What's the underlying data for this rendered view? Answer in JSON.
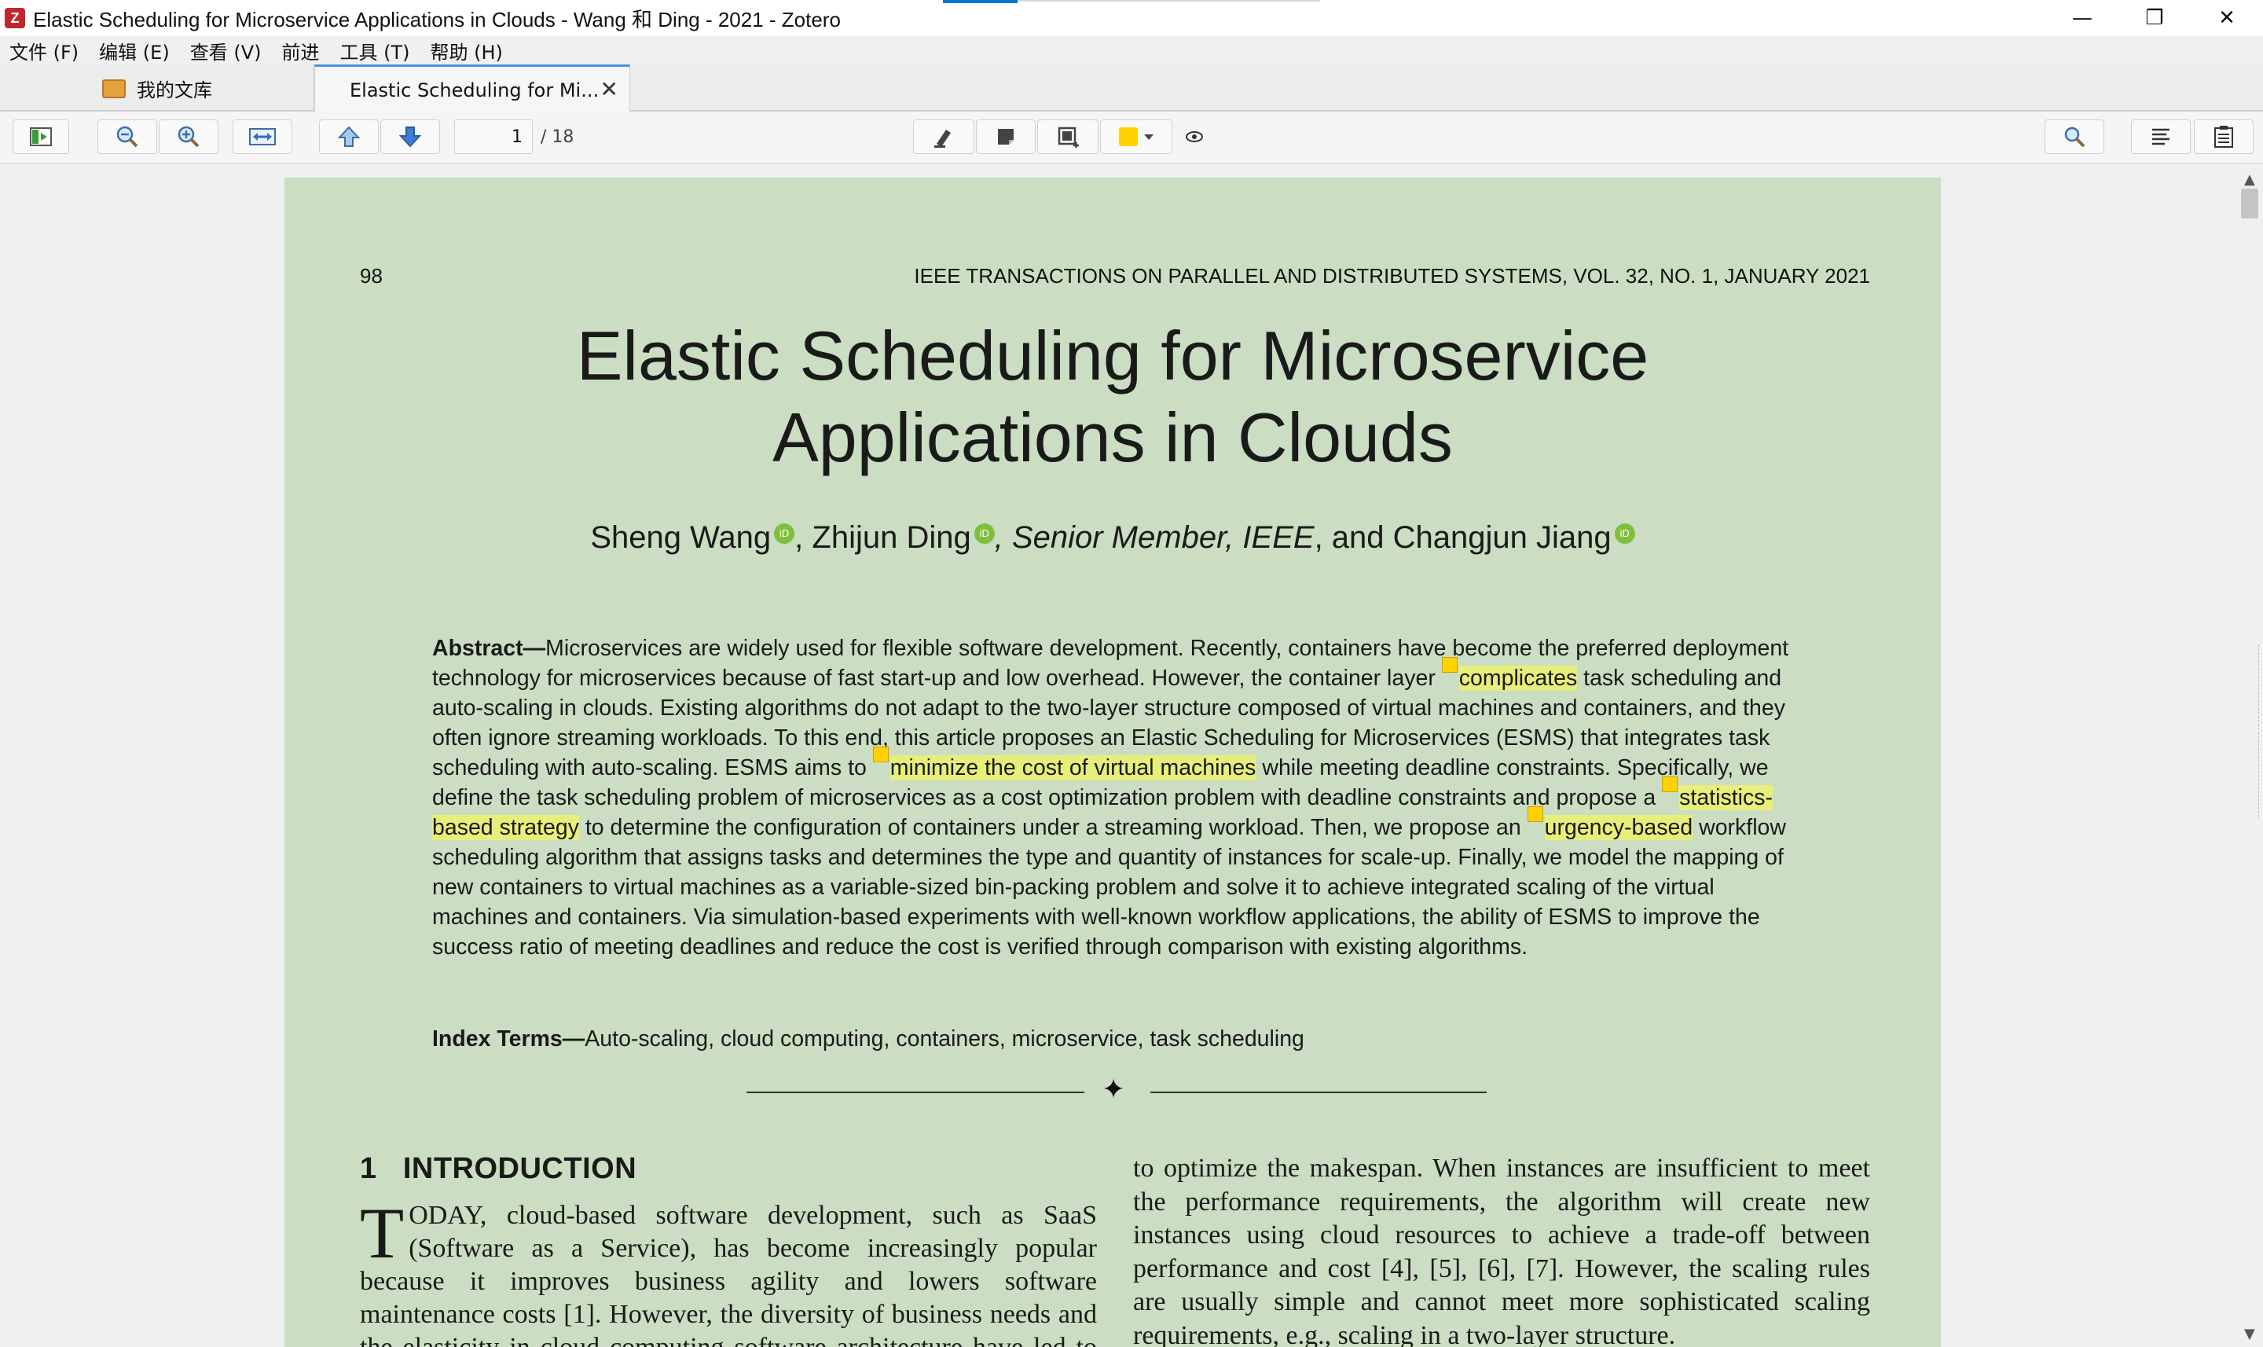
{
  "window": {
    "title": "Elastic Scheduling for Microservice Applications in Clouds - Wang 和 Ding - 2021 - Zotero",
    "minimize": "—",
    "restore": "❐",
    "close": "✕"
  },
  "menu": [
    "文件 (F)",
    "编辑 (E)",
    "查看 (V)",
    "前进",
    "工具 (T)",
    "帮助 (H)"
  ],
  "tabs": {
    "library": "我的文库",
    "reader": "Elastic Scheduling for Mi...",
    "close": "✕"
  },
  "toolbar": {
    "current_page": "1",
    "total_pages": "/ 18"
  },
  "paper": {
    "page_number": "98",
    "journal": "IEEE TRANSACTIONS ON PARALLEL AND DISTRIBUTED SYSTEMS, VOL. 32, NO. 1, JANUARY 2021",
    "title_line1": "Elastic Scheduling for Microservice",
    "title_line2": "Applications in Clouds",
    "author1": "Sheng Wang",
    "author2": ", Zhijun Ding",
    "author2_title": ", Senior Member, IEEE",
    "author3": ", and Changjun Jiang",
    "orcid": "iD",
    "abstract_label": "Abstract—",
    "abstract_p1": "Microservices are widely used for flexible software development. Recently, containers have become the preferred deployment technology for microservices because of fast start-up and low overhead. However, the container layer ",
    "hl1": "complicates",
    "abstract_p2": " task scheduling and auto-scaling in clouds. Existing algorithms do not adapt to the two-layer structure composed of virtual machines and containers, and they often ignore streaming workloads. To this end, this article proposes an Elastic Scheduling for Microservices (ESMS) that integrates task scheduling with auto-scaling. ESMS aims to ",
    "hl2": "minimize the cost of virtual machines",
    "abstract_p3": " while meeting deadline constraints. Specifically, we define the task scheduling problem of microservices as a cost optimization problem with deadline constraints and propose a ",
    "hl3": "statistics-based strategy",
    "abstract_p4": " to determine the configuration of containers under a streaming workload. Then, we propose an ",
    "hl4": "urgency-based",
    "abstract_p5": " workflow scheduling algorithm that assigns tasks and determines the type and quantity of instances for scale-up. Finally, we model the mapping of new containers to virtual machines as a variable-sized bin-packing problem and solve it to achieve integrated scaling of the virtual machines and containers. Via simulation-based experiments with well-known workflow applications, the ability of ESMS to improve the success ratio of meeting deadlines and reduce the cost is verified through comparison with existing algorithms.",
    "index_label": "Index Terms—",
    "index_terms": "Auto-scaling, cloud computing, containers, microservice, task scheduling",
    "divider_glyph": "✦",
    "section_number": "1",
    "section_title": "INTRODUCTION",
    "intro_dropcap": "T",
    "intro_left": "ODAY, cloud-based software development, such as SaaS (Software as a Service), has become increasingly popular because it improves business agility and lowers software maintenance costs [1]. However, the diversity of business needs and the elasticity in cloud computing software architecture have led to the rise of microservices.",
    "intro_right": "to optimize the makespan. When instances are insufficient to meet the performance requirements, the algorithm will create new instances using cloud resources to achieve a trade-off between performance and cost [4], [5], [6], [7]. However, the scaling rules are usually simple and cannot meet more sophisticated scaling requirements, e.g., scaling in a two-layer structure."
  },
  "colors": {
    "page_background": "#cbddc2",
    "highlight": "#e7ef7a",
    "note_marker": "#ffd200",
    "annotation_color": "#ffd200",
    "tab_accent": "#4a90d9"
  }
}
